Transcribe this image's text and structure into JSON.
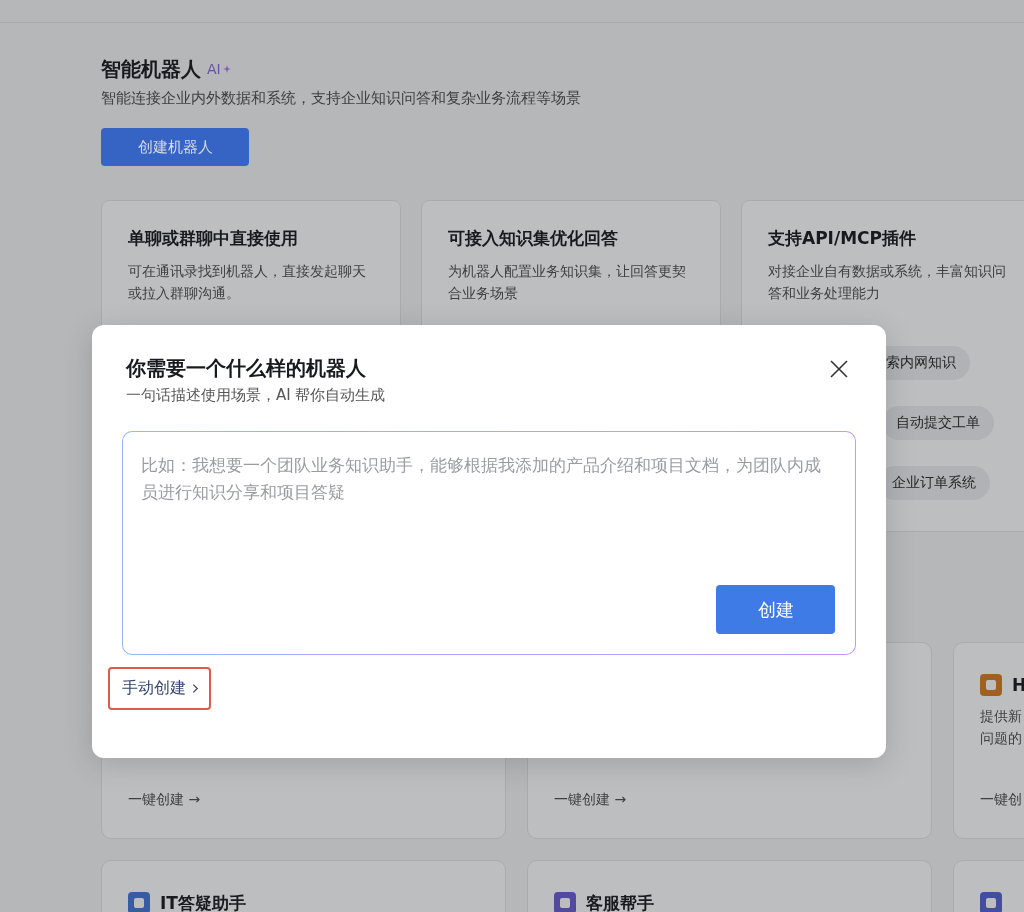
{
  "section": {
    "title": "智能机器人",
    "badge": "AI",
    "description": "智能连接企业内外数据和系统，支持企业知识问答和复杂业务流程等场景",
    "create_button": "创建机器人"
  },
  "features": [
    {
      "title": "单聊或群聊中直接使用",
      "description": "可在通讯录找到机器人，直接发起聊天或拉入群聊沟通。"
    },
    {
      "title": "可接入知识集优化回答",
      "description": "为机器人配置业务知识集，让回答更契合业务场景"
    },
    {
      "title": "支持API/MCP插件",
      "description": "对接企业自有数据或系统，丰富知识问答和业务处理能力",
      "tags": [
        "索内网知识",
        "自动提交工单",
        "企业订单系统"
      ]
    }
  ],
  "templates": [
    {
      "action": "一键创建 →"
    },
    {
      "action": "一键创建 →"
    },
    {
      "title": "H",
      "description_lines": [
        "提供新",
        "问题的"
      ],
      "action": "一键创",
      "color": "#a16020"
    },
    {
      "title": "IT答疑助手",
      "color": "#375ca2"
    },
    {
      "title": "客服帮手",
      "color": "#5249a1"
    },
    {
      "color": "#434e9e"
    }
  ],
  "modal": {
    "title": "你需要一个什么样的机器人",
    "subtitle": "一句话描述使用场景，AI 帮你自动生成",
    "placeholder": "比如：我想要一个团队业务知识助手，能够根据我添加的产品介绍和项目文档，为团队内成员进行知识分享和项目答疑",
    "submit_button": "创建",
    "manual_link": {
      "label": "手动创建",
      "highlighted": true
    }
  }
}
